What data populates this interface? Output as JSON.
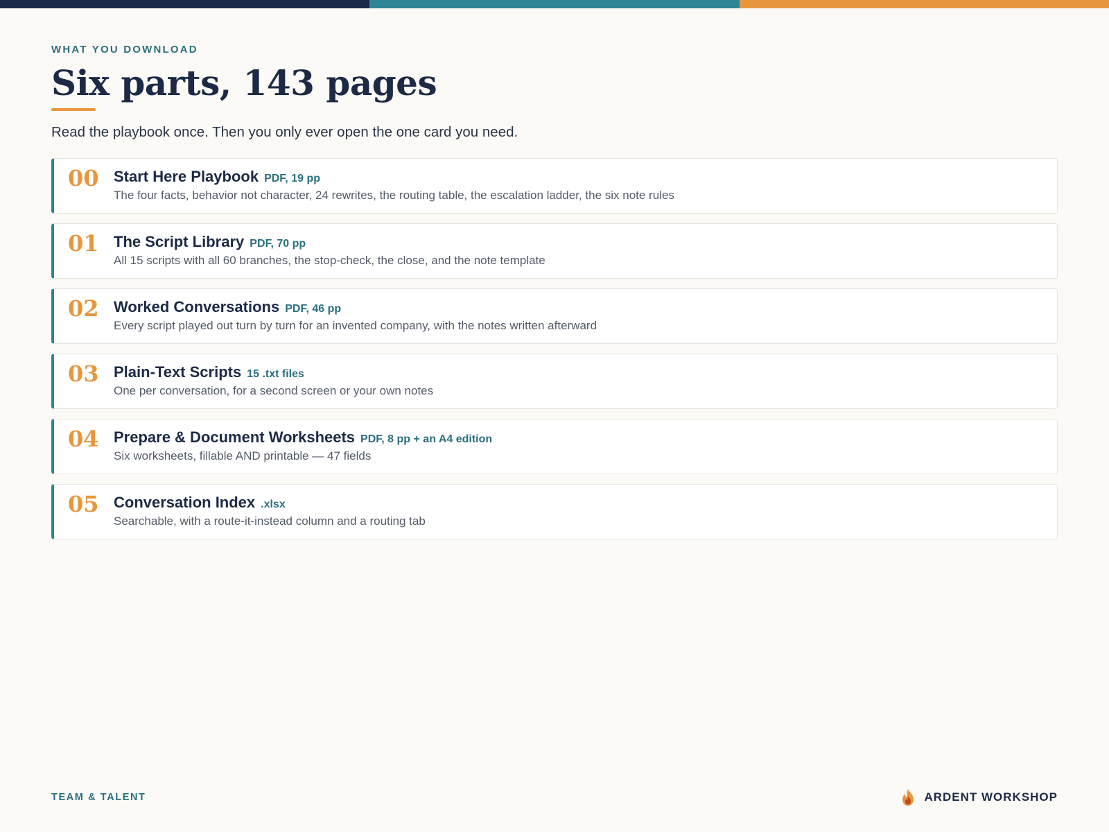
{
  "header": {
    "eyebrow": "WHAT YOU DOWNLOAD",
    "title": "Six parts, 143 pages",
    "subtitle": "Read the playbook once. Then you only ever open the one card you need."
  },
  "colors": {
    "navy": "#1c2a46",
    "teal": "#2f8494",
    "orange": "#e8963d",
    "background": "#fbfaf6"
  },
  "items": [
    {
      "number": "00",
      "title": "Start Here Playbook",
      "meta": "PDF, 19 pp",
      "description": "The four facts, behavior not character, 24 rewrites, the routing table, the escalation ladder, the six note rules"
    },
    {
      "number": "01",
      "title": "The Script Library",
      "meta": "PDF, 70 pp",
      "description": "All 15 scripts with all 60 branches, the stop-check, the close, and the note template"
    },
    {
      "number": "02",
      "title": "Worked Conversations",
      "meta": "PDF, 46 pp",
      "description": "Every script played out turn by turn for an invented company, with the notes written afterward"
    },
    {
      "number": "03",
      "title": "Plain-Text Scripts",
      "meta": "15 .txt files",
      "description": "One per conversation, for a second screen or your own notes"
    },
    {
      "number": "04",
      "title": "Prepare & Document Worksheets",
      "meta": "PDF, 8 pp + an A4 edition",
      "description": "Six worksheets, fillable AND printable — 47 fields"
    },
    {
      "number": "05",
      "title": "Conversation Index",
      "meta": ".xlsx",
      "description": "Searchable, with a route-it-instead column and a routing tab"
    }
  ],
  "footer": {
    "left": "TEAM & TALENT",
    "brand": "ARDENT WORKSHOP",
    "logo_icon": "flame-icon"
  }
}
